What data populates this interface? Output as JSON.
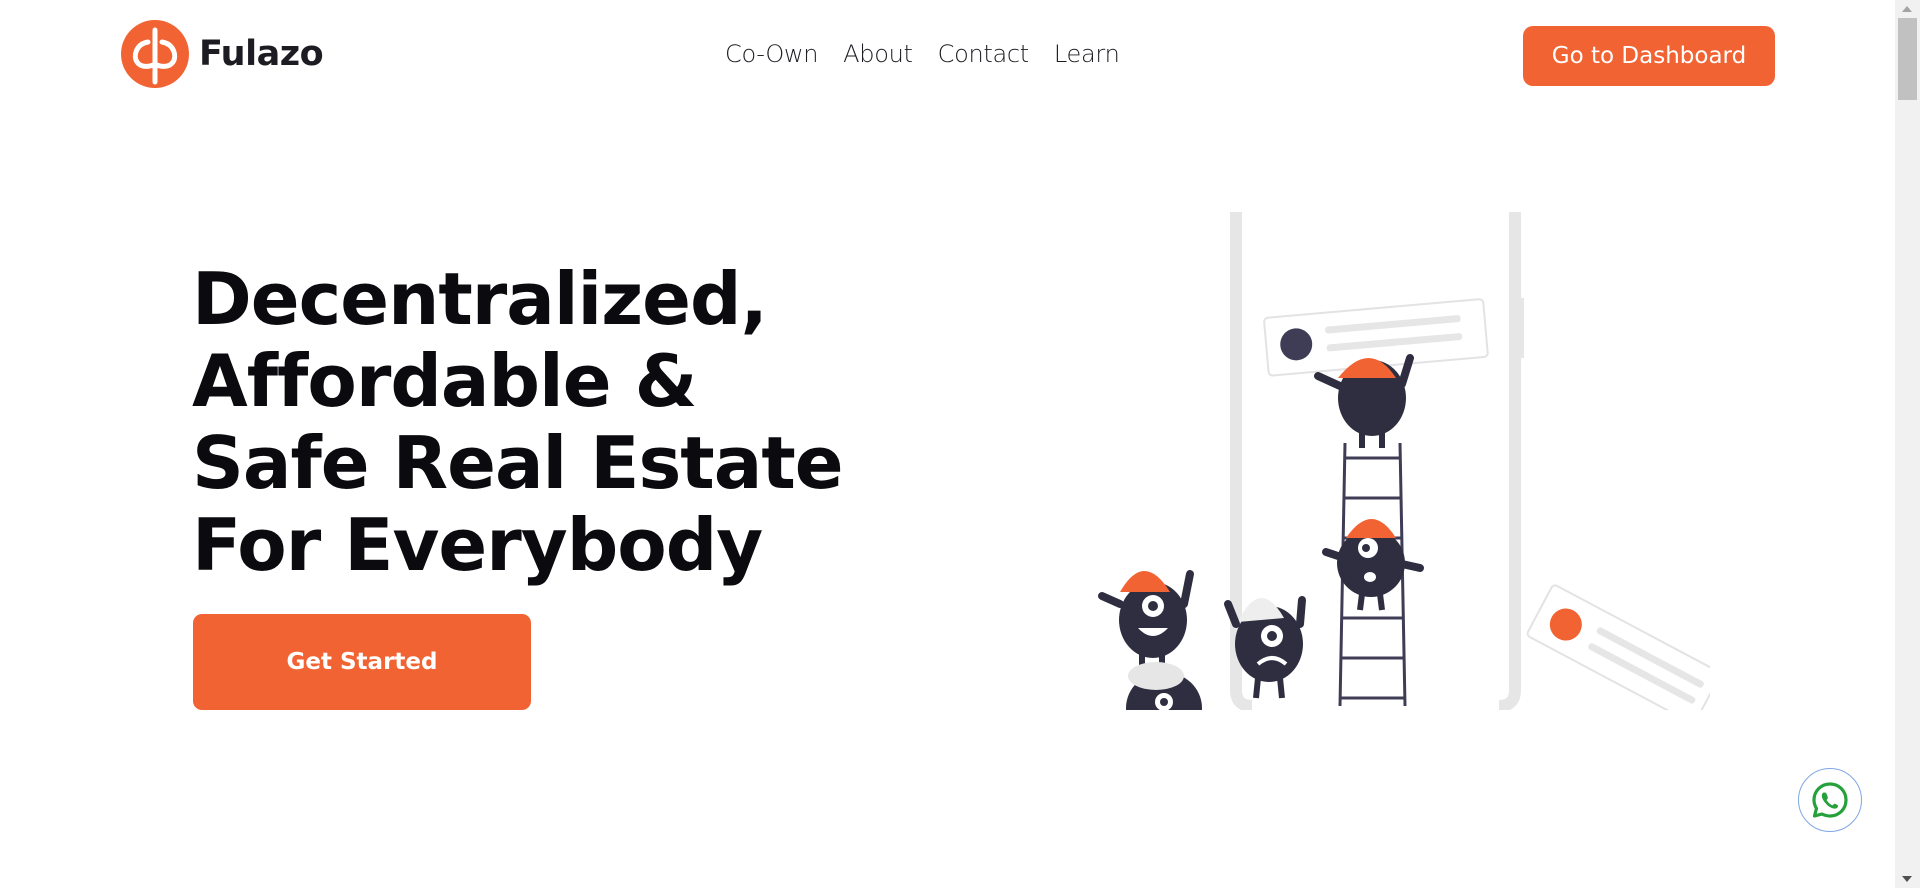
{
  "brand": {
    "name": "Fulazo",
    "accent_color": "#f16333",
    "logo_icon": "phi-circle-logo"
  },
  "nav": {
    "items": [
      {
        "label": "Co-Own"
      },
      {
        "label": "About"
      },
      {
        "label": "Contact"
      },
      {
        "label": "Learn"
      }
    ],
    "dashboard_label": "Go to Dashboard"
  },
  "hero": {
    "title_lines": [
      "Decentralized,",
      "Affordable &",
      "Safe Real Estate",
      "For Everybody"
    ],
    "cta_label": "Get Started",
    "illustration_icon": "team-building-illustration"
  },
  "floating": {
    "whatsapp_icon": "whatsapp-icon"
  }
}
